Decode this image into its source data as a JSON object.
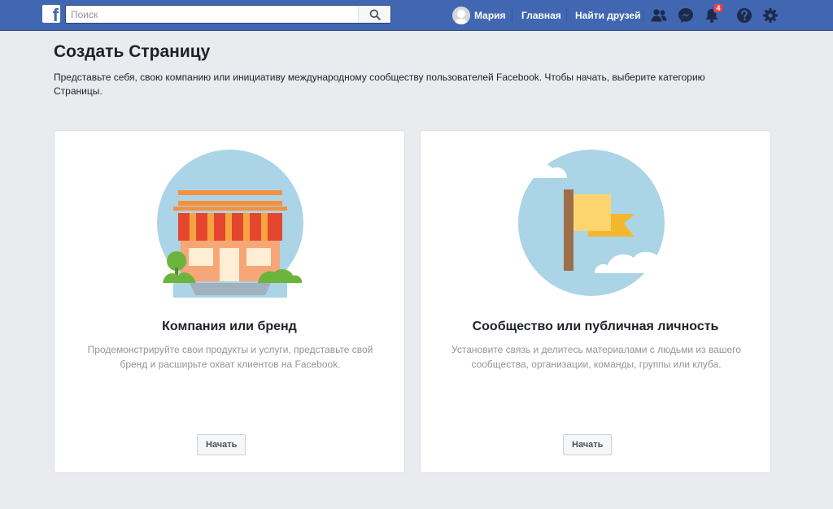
{
  "topbar": {
    "logo_letter": "f",
    "search_placeholder": "Поиск",
    "user_name": "Мария",
    "home_label": "Главная",
    "find_friends_label": "Найти друзей",
    "notifications_count": "4",
    "icons": [
      "friend-requests-icon",
      "messenger-icon",
      "notifications-icon",
      "help-icon",
      "settings-icon"
    ]
  },
  "page": {
    "title": "Создать Страницу",
    "description": "Представьте себя, свою компанию или инициативу международному сообществу пользователей Facebook. Чтобы начать, выберите категорию Страницы."
  },
  "cards": [
    {
      "title": "Компания или бренд",
      "description": "Продемонстрируйте свои продукты и услуги, представьте свой бренд и расширьте охват клиентов на Facebook.",
      "button": "Начать",
      "illustration": "storefront-icon"
    },
    {
      "title": "Сообщество или публичная личность",
      "description": "Установите связь и делитесь материалами с людьми из вашего сообщества, организации, команды, группы или клуба.",
      "button": "Начать",
      "illustration": "flag-icon"
    }
  ],
  "colors": {
    "brand_blue": "#4267b2",
    "background": "#e9ebee",
    "badge_red": "#fa3e3e"
  }
}
